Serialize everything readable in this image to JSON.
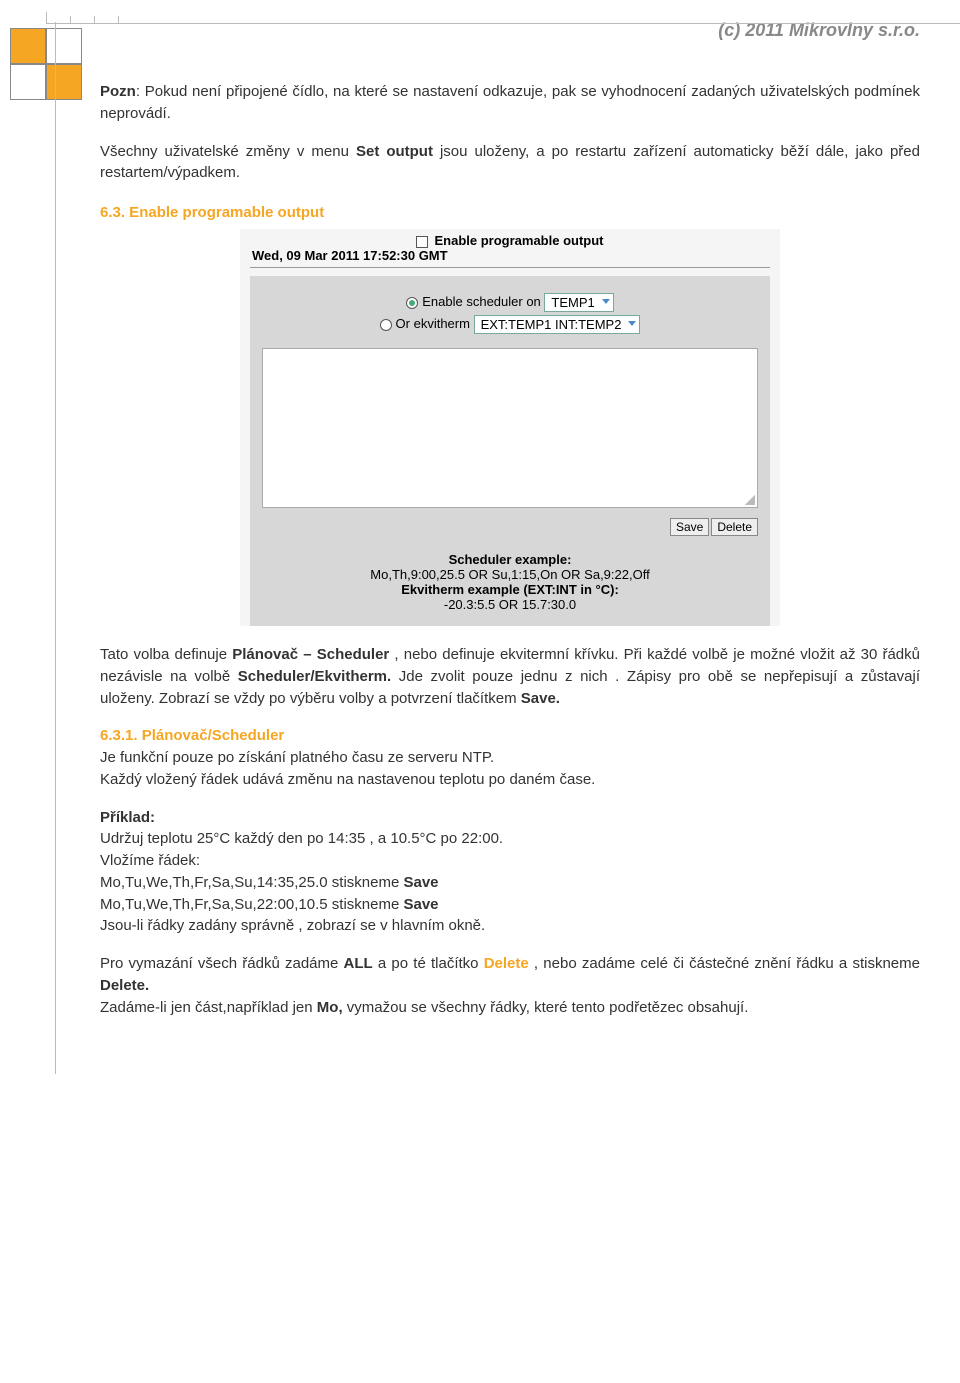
{
  "header": {
    "copyright": "(c) 2011 Mikrovlny s.r.o."
  },
  "intro": {
    "note_label": "Pozn",
    "note_text": ": Pokud není připojené čídlo, na které se nastavení odkazuje, pak se vyhodnocení zadaných uživatelských podmínek  neprovádí.",
    "para2_a": "Všechny uživatelské změny v menu ",
    "para2_bold": "Set output",
    "para2_b": " jsou uloženy, a po restartu zařízení automaticky běží dále, jako před restartem/výpadkem."
  },
  "section63": {
    "title": "6.3. Enable programable output"
  },
  "ui": {
    "checkbox_label": "Enable programable output",
    "datetime": "Wed, 09 Mar 2011 17:52:30 GMT",
    "radio1_label": "Enable scheduler on",
    "radio1_sel": "TEMP1",
    "radio2_label": "Or ekvitherm",
    "radio2_sel": "EXT:TEMP1 INT:TEMP2",
    "btn_save": "Save",
    "btn_delete": "Delete",
    "ex_sched_label": "Scheduler example:",
    "ex_sched_line": "Mo,Th,9:00,25.5   OR  Su,1:15,On   OR  Sa,9:22,Off",
    "ex_ekv_label": "Ekvitherm example (EXT:INT in °C):",
    "ex_ekv_line": "-20.3:5.5 OR 15.7:30.0"
  },
  "body63": {
    "p_a": "Tato volba definuje ",
    "p_b1": "Plánovač – Scheduler",
    "p_c": " , nebo definuje ekvitermní křívku. Při každé volbě je možné vložit až 30 řádků nezávisle na volbě ",
    "p_b2": "Scheduler/Ekvitherm.",
    "p_d": " Jde zvolit pouze jednu z nich . Zápisy pro obě se nepřepisují a zůstavají uloženy. Zobrazí se vždy po výběru volby a potvrzení tlačítkem ",
    "p_b3": "Save.",
    "s631_title": "6.3.1. Plánovač/Scheduler",
    "s631_l1": "Je funkční pouze po získání platného času ze serveru NTP.",
    "s631_l2": "Každý vložený řádek udává změnu na nastavenou teplotu po daném čase.",
    "ex_label": "Příklad:",
    "ex_l1": "Udržuj teplotu 25°C každý den po 14:35 ,  a 10.5°C po 22:00.",
    "ex_l2": "Vložíme řádek:",
    "ex_l3a": "Mo,Tu,We,Th,Fr,Sa,Su,14:35,25.0  stiskneme ",
    "ex_l3b": "Save",
    "ex_l4a": "Mo,Tu,We,Th,Fr,Sa,Su,22:00,10.5 stiskneme ",
    "ex_l4b": "Save",
    "ex_l5": "Jsou-li řádky zadány správně , zobrazí se v hlavním okně.",
    "del_a": "Pro vymazání všech řádků zadáme ",
    "del_all": "ALL",
    "del_b": " a po té tlačítko  ",
    "del_btn": "Delete",
    "del_c": " , nebo zadáme celé či částečné znění řádku a stiskneme ",
    "del_btn2": "Delete.",
    "del_d": "Zadáme-li jen část,například jen ",
    "del_mo": "Mo,",
    "del_e": " vymažou se všechny řádky, které tento podřetězec obsahují."
  }
}
